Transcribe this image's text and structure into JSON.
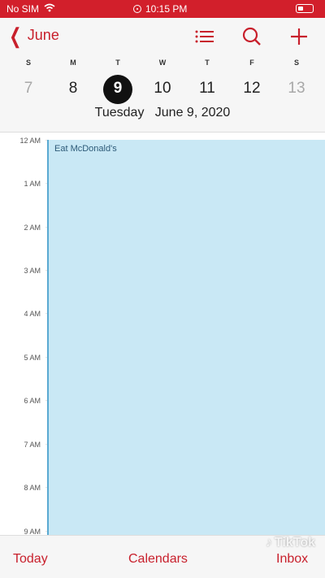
{
  "status_bar": {
    "carrier": "No SIM",
    "time": "10:15 PM"
  },
  "header": {
    "back_label": "June",
    "weekdays": [
      "S",
      "M",
      "T",
      "W",
      "T",
      "F",
      "S"
    ],
    "dates": [
      "7",
      "8",
      "9",
      "10",
      "11",
      "12",
      "13"
    ],
    "selected_date_index": 2,
    "selected_title": "Tuesday   June 9, 2020"
  },
  "icons": {
    "list": "list-icon",
    "search": "search-icon",
    "add": "add-icon",
    "accent_color": "#c8202c"
  },
  "day_view": {
    "hours": [
      "12 AM",
      "1 AM",
      "2 AM",
      "3 AM",
      "4 AM",
      "5 AM",
      "6 AM",
      "7 AM",
      "8 AM",
      "9 AM"
    ],
    "event": {
      "title": "Eat McDonald's",
      "color": "#c9e8f5"
    }
  },
  "tab_bar": {
    "today": "Today",
    "calendars": "Calendars",
    "inbox": "Inbox"
  },
  "watermark": "TikTok"
}
